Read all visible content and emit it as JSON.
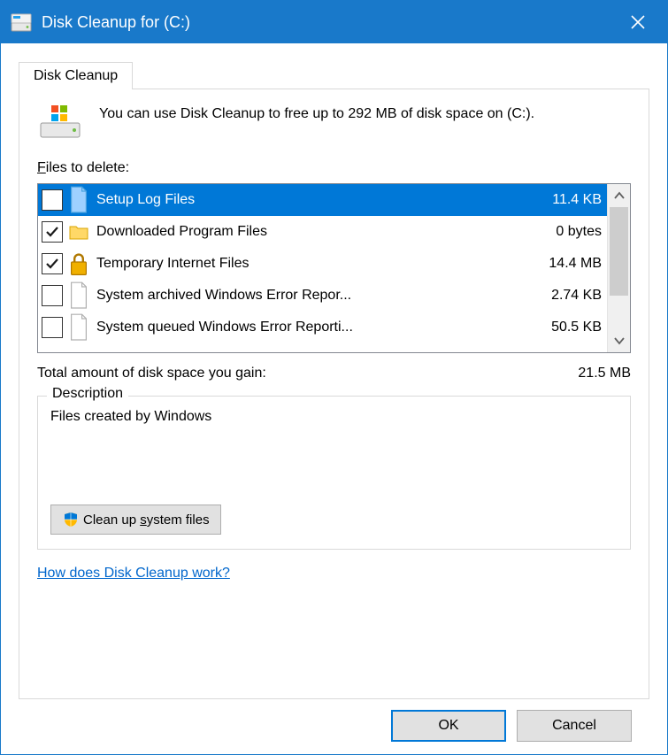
{
  "window": {
    "title": "Disk Cleanup for  (C:)"
  },
  "tab": {
    "label": "Disk Cleanup"
  },
  "intro": {
    "text": "You can use Disk Cleanup to free up to 292 MB of disk space on  (C:)."
  },
  "files_label_pre": "F",
  "files_label_post": "iles to delete:",
  "file_items": [
    {
      "checked": false,
      "icon": "page-blue",
      "name": "Setup Log Files",
      "size": "11.4 KB",
      "selected": true
    },
    {
      "checked": true,
      "icon": "folder",
      "name": "Downloaded Program Files",
      "size": "0 bytes",
      "selected": false
    },
    {
      "checked": true,
      "icon": "lock",
      "name": "Temporary Internet Files",
      "size": "14.4 MB",
      "selected": false
    },
    {
      "checked": false,
      "icon": "page",
      "name": "System archived Windows Error Repor...",
      "size": "2.74 KB",
      "selected": false
    },
    {
      "checked": false,
      "icon": "page",
      "name": "System queued Windows Error Reporti...",
      "size": "50.5 KB",
      "selected": false
    }
  ],
  "total": {
    "label": "Total amount of disk space you gain:",
    "value": "21.5 MB"
  },
  "description": {
    "legend": "Description",
    "text": "Files created by Windows"
  },
  "cleanup_button_pre": "Clean up ",
  "cleanup_button_ul": "s",
  "cleanup_button_post": "ystem files",
  "help_link": "How does Disk Cleanup work?",
  "buttons": {
    "ok": "OK",
    "cancel": "Cancel"
  }
}
